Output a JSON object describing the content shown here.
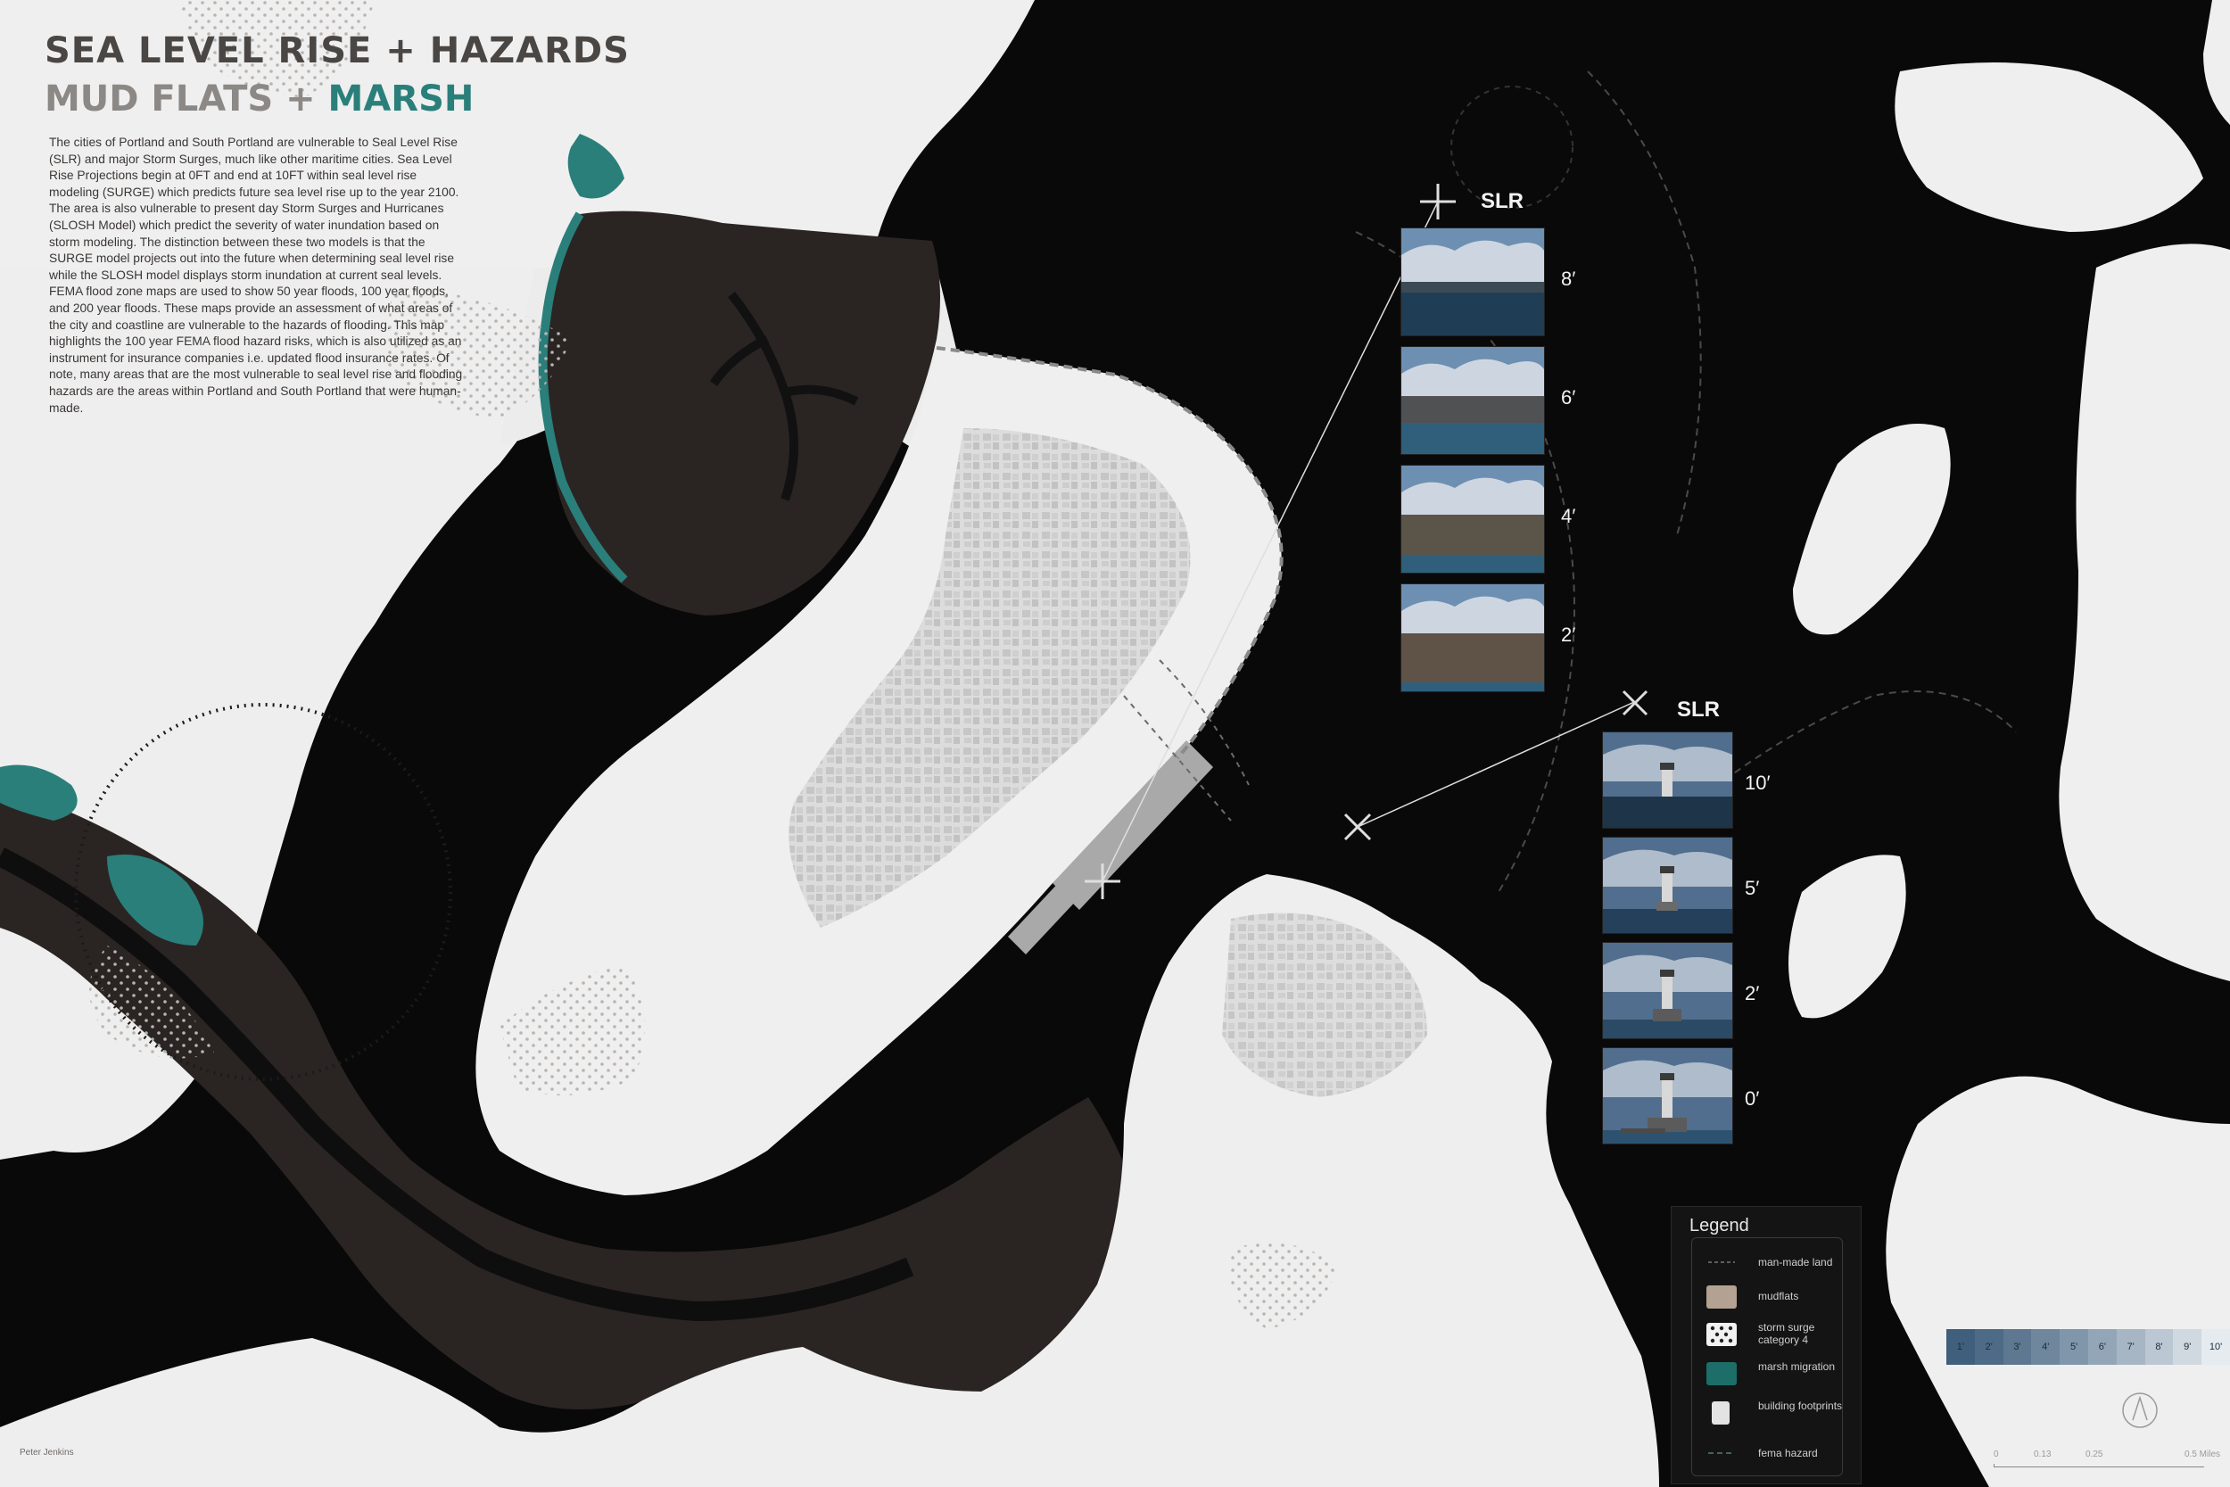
{
  "title": {
    "line1": "SEA LEVEL RISE + HAZARDS",
    "line2_a": "MUD FLATS",
    "line2_plus": " + ",
    "line2_b": "MARSH"
  },
  "description": "The cities of Portland and South Portland are vulnerable to Seal Level Rise (SLR) and major Storm Surges, much like other maritime cities. Sea Level Rise Projections begin at 0FT and end at 10FT within seal level rise modeling (SURGE) which predicts future sea level rise up to the year 2100. The area is also vulnerable to present day Storm Surges and Hurricanes (SLOSH Model) which predict the severity of water inundation based on storm modeling. The distinction between these two models is that the SURGE model projects out into the future when determining seal level rise while the SLOSH model displays storm inundation at current seal levels. FEMA flood zone maps are used to show 50 year floods, 100 year floods, and 200 year floods. These maps provide an assessment of what areas of the city and coastline are vulnerable to the hazards of flooding. This map highlights the 100 year FEMA flood hazard risks, which is also utilized as an instrument for insurance companies i.e. updated flood insurance rates. Of note, many areas that are the most vulnerable to seal level rise and flooding hazards are the areas within Portland and South Portland that were human-made.",
  "credit": "Peter Jenkins",
  "slr_groups": [
    {
      "label": "SLR",
      "levels": [
        "8′",
        "6′",
        "4′",
        "2′"
      ]
    },
    {
      "label": "SLR",
      "levels": [
        "10′",
        "5′",
        "2′",
        "0′"
      ]
    }
  ],
  "legend": {
    "title": "Legend",
    "items": [
      {
        "label": "man-made land",
        "icon": "dashed-line"
      },
      {
        "label": "mudflats",
        "color": "#b3a192"
      },
      {
        "label": "storm surge category 4",
        "icon": "dot-pattern"
      },
      {
        "label": "marsh migration",
        "color": "#1d6e68"
      },
      {
        "label": "building footprints",
        "color": "#e3e3e3"
      },
      {
        "label": "fema hazard",
        "icon": "dashed-line"
      }
    ]
  },
  "slr_scale": {
    "labels": [
      "1'",
      "2'",
      "3'",
      "4'",
      "5'",
      "6'",
      "7'",
      "8'",
      "9'",
      "10'"
    ],
    "colors": [
      "#3f5f7c",
      "#4d6b86",
      "#5d7890",
      "#6e879d",
      "#8096aa",
      "#93a6b7",
      "#a7b6c4",
      "#bbc7d2",
      "#d0d9e0",
      "#e5ebef"
    ]
  },
  "map_scale": {
    "ticks": [
      "0",
      "0.13",
      "0.25",
      "0.5 Miles"
    ]
  },
  "colors": {
    "water": "#0a0909",
    "land": "#efefef",
    "mudflat": "#2a2523",
    "marsh": "#2a7f7a",
    "urban": "#c9c9c9"
  }
}
